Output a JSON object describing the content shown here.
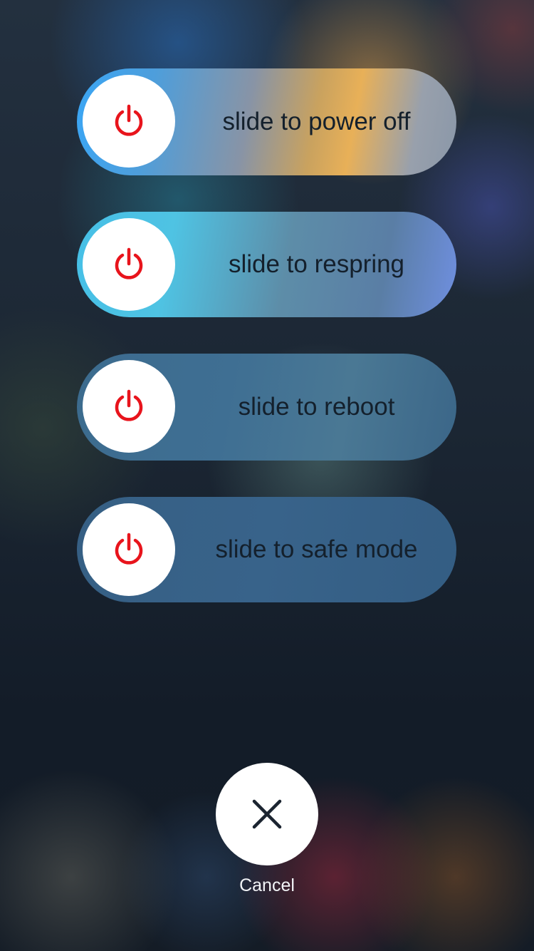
{
  "sliders": [
    {
      "label": "slide to power off",
      "icon": "power-icon"
    },
    {
      "label": "slide to respring",
      "icon": "power-icon"
    },
    {
      "label": "slide to reboot",
      "icon": "power-icon"
    },
    {
      "label": "slide to safe mode",
      "icon": "power-icon"
    }
  ],
  "cancel": {
    "label": "Cancel",
    "icon": "close-icon"
  },
  "colors": {
    "power_icon": "#e8141c",
    "knob": "#ffffff",
    "slider_text": "#14202c",
    "cancel_text": "#f2f4f7"
  }
}
